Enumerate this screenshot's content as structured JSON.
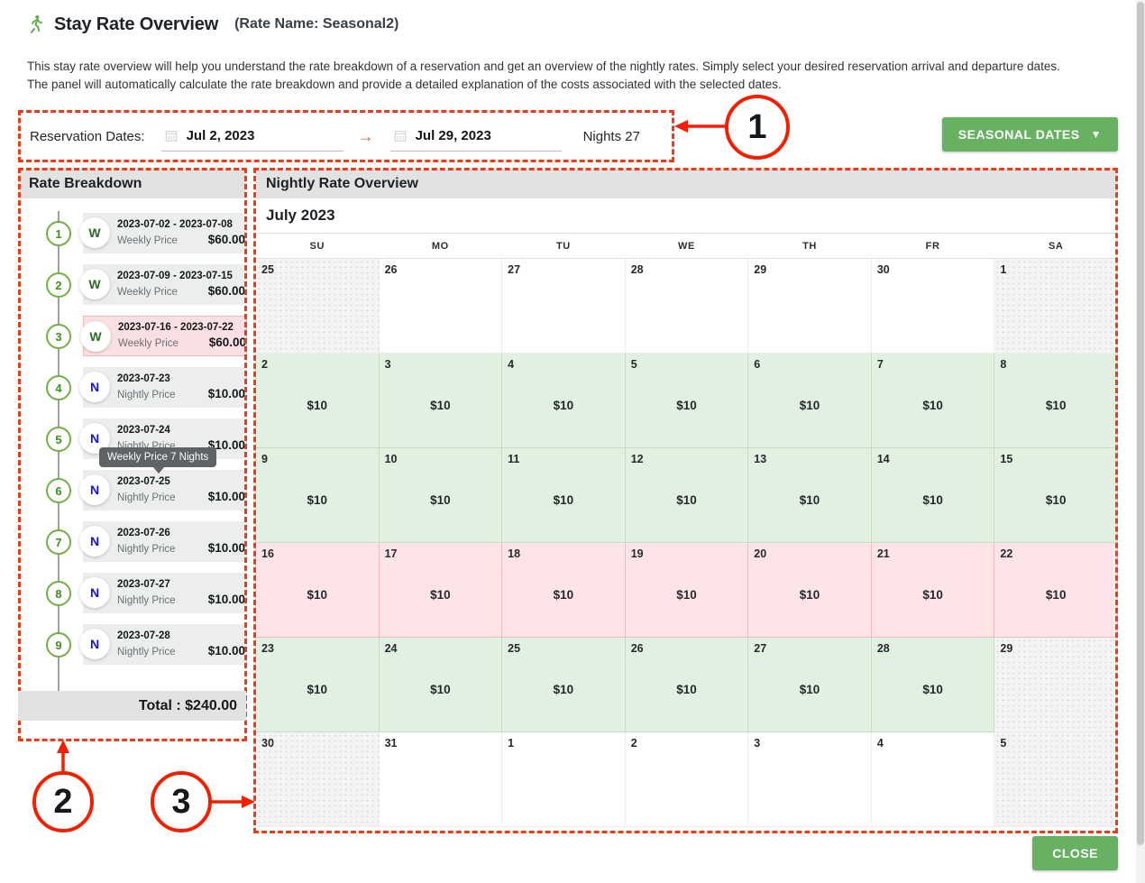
{
  "header": {
    "icon": "running-man-icon",
    "title": "Stay Rate Overview",
    "rate_name": "(Rate Name: Seasonal2)",
    "description_line1": "This stay rate overview will help you understand the rate breakdown of a reservation and get an overview of the nightly rates. Simply select your desired reservation arrival and departure dates.",
    "description_line2": "The panel will automatically calculate the rate breakdown and provide a detailed explanation of the costs associated with the selected dates."
  },
  "reservation": {
    "label": "Reservation Dates:",
    "start_date": "Jul 2, 2023",
    "end_date": "Jul 29, 2023",
    "separator": "→",
    "nights_label": "Nights 27",
    "seasonal_button": "SEASONAL DATES",
    "chevron": "⌄"
  },
  "rate_breakdown": {
    "panel_title": "Rate Breakdown",
    "tooltip": "Weekly Price 7 Nights",
    "total_label": "Total : $240.00",
    "items": [
      {
        "n": "1",
        "badge": "W",
        "badge_type": "w",
        "date": "2023-07-02 - 2023-07-08",
        "kind": "Weekly Price",
        "amount": "$60.00",
        "flagged": false
      },
      {
        "n": "2",
        "badge": "W",
        "badge_type": "w",
        "date": "2023-07-09 - 2023-07-15",
        "kind": "Weekly Price",
        "amount": "$60.00",
        "flagged": false
      },
      {
        "n": "3",
        "badge": "W",
        "badge_type": "w",
        "date": "2023-07-16 - 2023-07-22",
        "kind": "Weekly Price",
        "amount": "$60.00",
        "flagged": true
      },
      {
        "n": "4",
        "badge": "N",
        "badge_type": "n",
        "date": "2023-07-23",
        "kind": "Nightly Price",
        "amount": "$10.00",
        "flagged": false
      },
      {
        "n": "5",
        "badge": "N",
        "badge_type": "n",
        "date": "2023-07-24",
        "kind": "Nightly Price",
        "amount": "$10.00",
        "flagged": false
      },
      {
        "n": "6",
        "badge": "N",
        "badge_type": "n",
        "date": "2023-07-25",
        "kind": "Nightly Price",
        "amount": "$10.00",
        "flagged": false
      },
      {
        "n": "7",
        "badge": "N",
        "badge_type": "n",
        "date": "2023-07-26",
        "kind": "Nightly Price",
        "amount": "$10.00",
        "flagged": false
      },
      {
        "n": "8",
        "badge": "N",
        "badge_type": "n",
        "date": "2023-07-27",
        "kind": "Nightly Price",
        "amount": "$10.00",
        "flagged": false
      },
      {
        "n": "9",
        "badge": "N",
        "badge_type": "n",
        "date": "2023-07-28",
        "kind": "Nightly Price",
        "amount": "$10.00",
        "flagged": false
      }
    ]
  },
  "calendar": {
    "panel_title": "Nightly Rate Overview",
    "month_label": "July 2023",
    "weekdays": [
      "SU",
      "MO",
      "TU",
      "WE",
      "TH",
      "FR",
      "SA"
    ],
    "weeks": [
      [
        {
          "day": "25",
          "price": "",
          "state": "muted"
        },
        {
          "day": "26",
          "price": "",
          "state": "plain"
        },
        {
          "day": "27",
          "price": "",
          "state": "plain"
        },
        {
          "day": "28",
          "price": "",
          "state": "plain"
        },
        {
          "day": "29",
          "price": "",
          "state": "plain"
        },
        {
          "day": "30",
          "price": "",
          "state": "plain"
        },
        {
          "day": "1",
          "price": "",
          "state": "muted"
        }
      ],
      [
        {
          "day": "2",
          "price": "$10",
          "state": "green"
        },
        {
          "day": "3",
          "price": "$10",
          "state": "green"
        },
        {
          "day": "4",
          "price": "$10",
          "state": "green"
        },
        {
          "day": "5",
          "price": "$10",
          "state": "green"
        },
        {
          "day": "6",
          "price": "$10",
          "state": "green"
        },
        {
          "day": "7",
          "price": "$10",
          "state": "green"
        },
        {
          "day": "8",
          "price": "$10",
          "state": "green"
        }
      ],
      [
        {
          "day": "9",
          "price": "$10",
          "state": "green"
        },
        {
          "day": "10",
          "price": "$10",
          "state": "green"
        },
        {
          "day": "11",
          "price": "$10",
          "state": "green"
        },
        {
          "day": "12",
          "price": "$10",
          "state": "green"
        },
        {
          "day": "13",
          "price": "$10",
          "state": "green"
        },
        {
          "day": "14",
          "price": "$10",
          "state": "green"
        },
        {
          "day": "15",
          "price": "$10",
          "state": "green"
        }
      ],
      [
        {
          "day": "16",
          "price": "$10",
          "state": "pink"
        },
        {
          "day": "17",
          "price": "$10",
          "state": "pink"
        },
        {
          "day": "18",
          "price": "$10",
          "state": "pink"
        },
        {
          "day": "19",
          "price": "$10",
          "state": "pink"
        },
        {
          "day": "20",
          "price": "$10",
          "state": "pink"
        },
        {
          "day": "21",
          "price": "$10",
          "state": "pink"
        },
        {
          "day": "22",
          "price": "$10",
          "state": "pink"
        }
      ],
      [
        {
          "day": "23",
          "price": "$10",
          "state": "green"
        },
        {
          "day": "24",
          "price": "$10",
          "state": "green"
        },
        {
          "day": "25",
          "price": "$10",
          "state": "green"
        },
        {
          "day": "26",
          "price": "$10",
          "state": "green"
        },
        {
          "day": "27",
          "price": "$10",
          "state": "green"
        },
        {
          "day": "28",
          "price": "$10",
          "state": "green"
        },
        {
          "day": "29",
          "price": "",
          "state": "muted"
        }
      ],
      [
        {
          "day": "30",
          "price": "",
          "state": "muted"
        },
        {
          "day": "31",
          "price": "",
          "state": "plain"
        },
        {
          "day": "1",
          "price": "",
          "state": "plain"
        },
        {
          "day": "2",
          "price": "",
          "state": "plain"
        },
        {
          "day": "3",
          "price": "",
          "state": "plain"
        },
        {
          "day": "4",
          "price": "",
          "state": "plain"
        },
        {
          "day": "5",
          "price": "",
          "state": "muted"
        }
      ]
    ]
  },
  "annotations": [
    {
      "id": "1",
      "label": "1"
    },
    {
      "id": "2",
      "label": "2"
    },
    {
      "id": "3",
      "label": "3"
    }
  ],
  "footer": {
    "close_label": "CLOSE"
  },
  "colors": {
    "accent_green": "#68b162",
    "annotation_red": "#f61e00",
    "dashed_red": "#ef3b18",
    "cell_green": "#e2f0e2",
    "cell_pink": "#fce4e7",
    "badge_weekly": "#2d6b22",
    "badge_nightly": "#1414d8"
  }
}
